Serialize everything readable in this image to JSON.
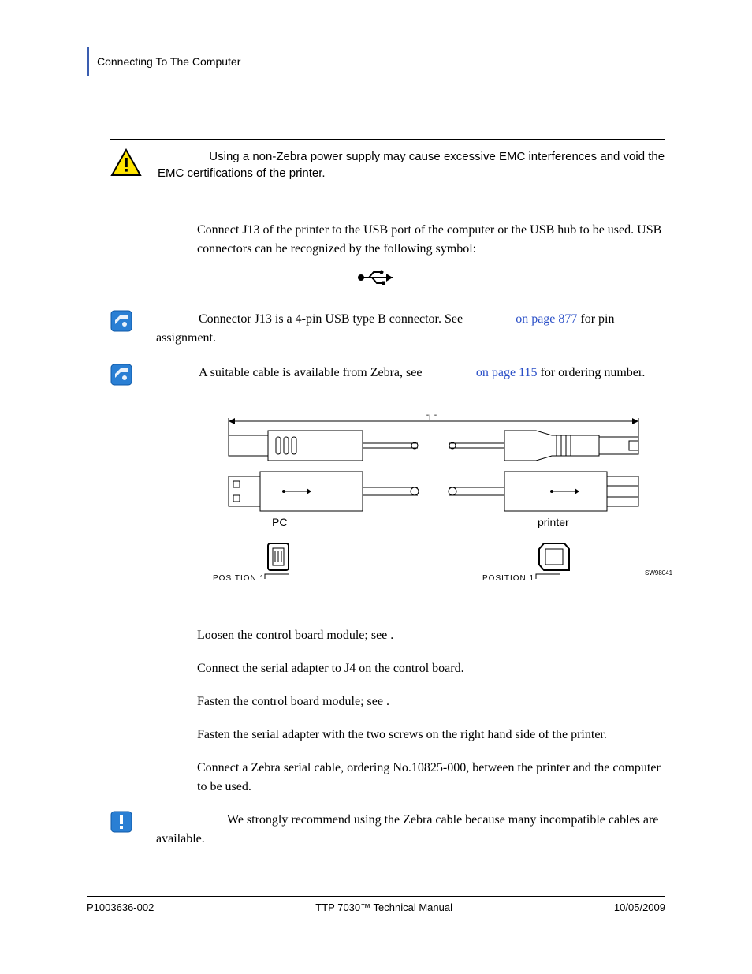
{
  "header": {
    "section_title": "Connecting To The Computer"
  },
  "caution": {
    "text": "Using a non-Zebra power supply may cause excessive EMC interferences and void the EMC certifications of the printer."
  },
  "usb_intro": "Connect J13 of the printer to the USB port of the computer or the USB hub to be used. USB connectors can be recognized by the following symbol:",
  "note1": {
    "before": "Connector J13 is a 4-pin USB type B connector. See ",
    "link": "on page 877",
    "after": " for pin assignment."
  },
  "note2": {
    "before": "A suitable cable is available from Zebra, see ",
    "link": "on page 115",
    "after": " for ordering number."
  },
  "figure": {
    "length_label": "\"L\"",
    "pc_label": "PC",
    "printer_label": "printer",
    "pos1a": "POSITION 1",
    "pos1b": "POSITION 1",
    "code": "SW98041"
  },
  "steps": {
    "s1": "Loosen the control board module; see                          .",
    "s2": "Connect the serial adapter to J4 on the control board.",
    "s3": "Fasten the control board module; see                          .",
    "s4": "Fasten the serial adapter with the two screws on the right hand side of the printer.",
    "s5": "Connect a Zebra serial cable, ordering No.10825-000, between the printer and the computer to be used."
  },
  "important": {
    "text": "We strongly recommend using the Zebra cable because many incompatible cables are available."
  },
  "footer": {
    "left": "P1003636-002",
    "center": "TTP 7030™ Technical Manual",
    "right": "10/05/2009"
  }
}
